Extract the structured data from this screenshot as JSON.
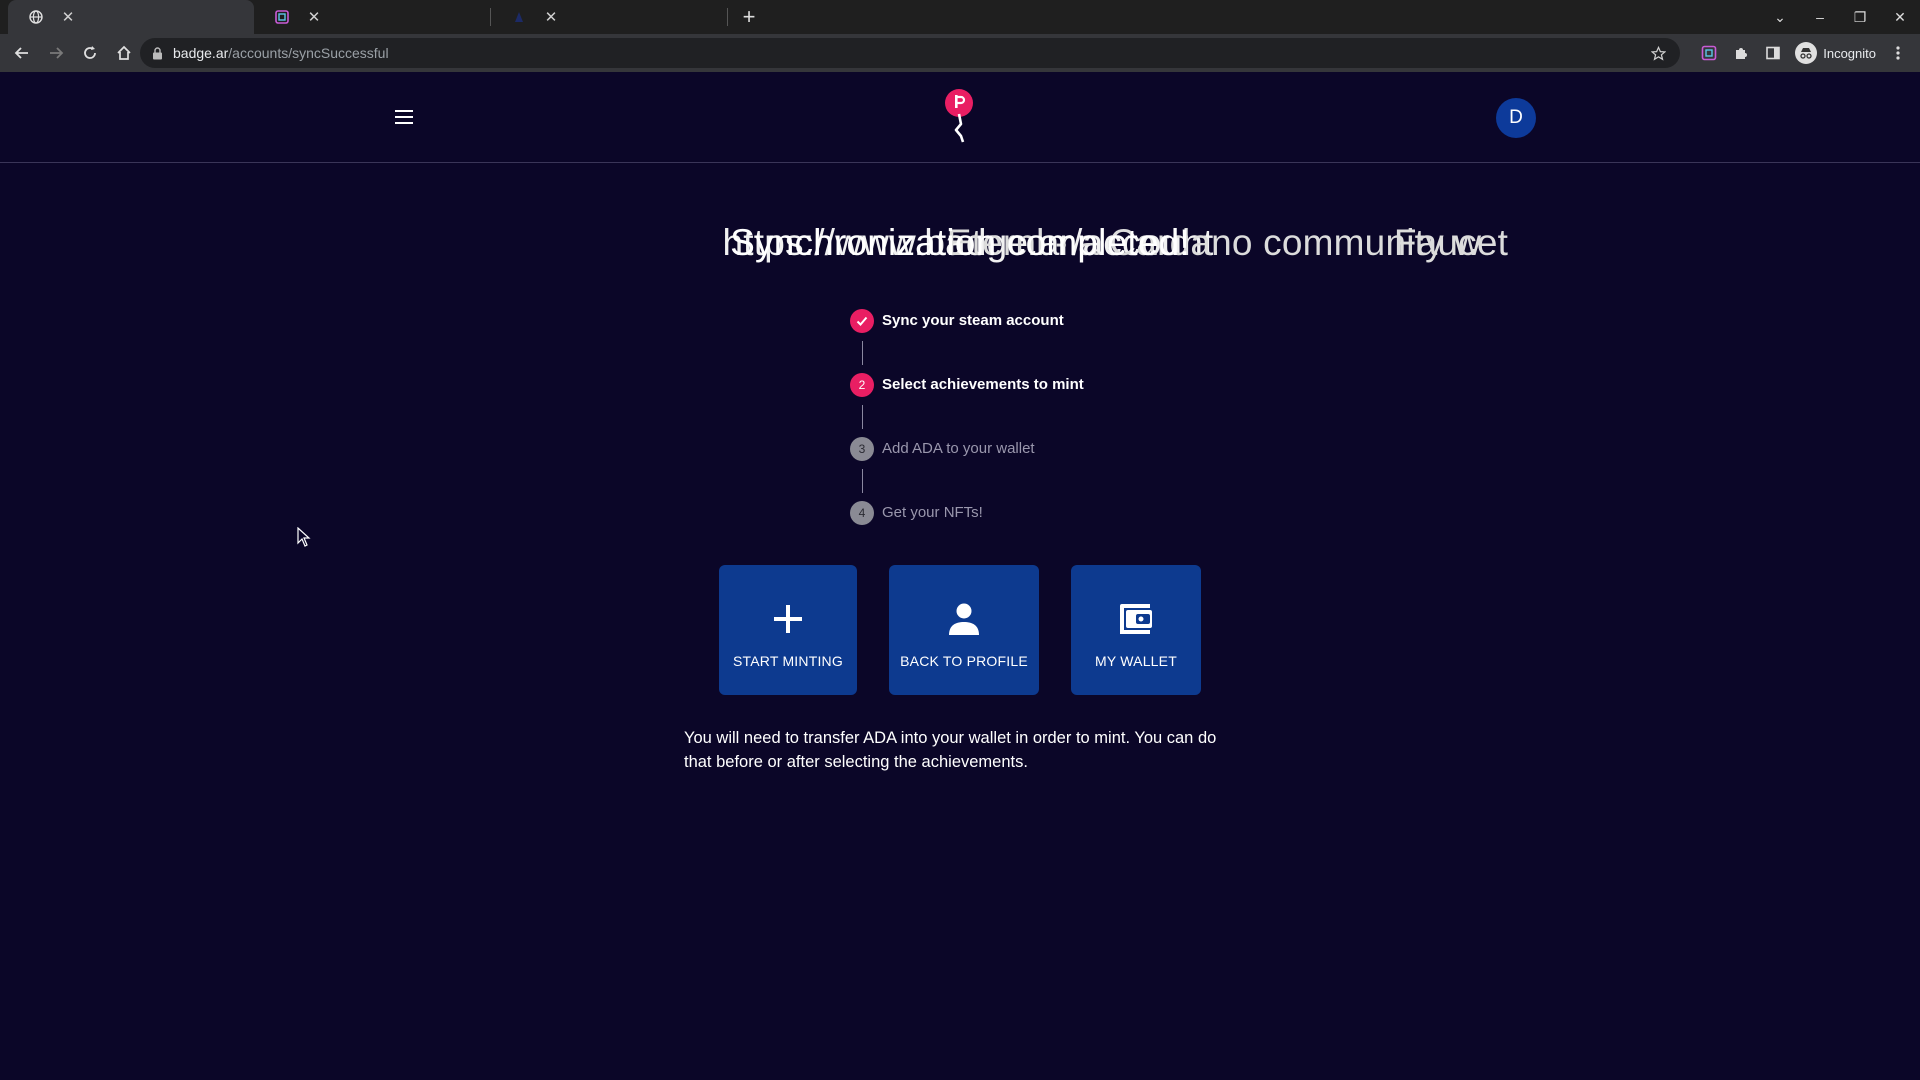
{
  "browser": {
    "tabs": [
      {
        "title": "https://www.badge.ar/account",
        "active": true
      },
      {
        "title": "Eternl - a Cardano community w",
        "active": false
      },
      {
        "title": "Faucet",
        "active": false
      }
    ],
    "url_host": "badge.ar",
    "url_path": "/accounts/syncSuccessful",
    "profile_label": "Incognito"
  },
  "header": {
    "avatar_letter": "D"
  },
  "main": {
    "title": "Synchronization completed!",
    "steps": [
      {
        "number": "",
        "label": "Sync your steam account",
        "state": "done"
      },
      {
        "number": "2",
        "label": "Select achievements to mint",
        "state": "active"
      },
      {
        "number": "3",
        "label": "Add ADA to your wallet",
        "state": "pending"
      },
      {
        "number": "4",
        "label": "Get your NFTs!",
        "state": "pending"
      }
    ],
    "actions": [
      {
        "label": "START MINTING",
        "icon": "plus-icon"
      },
      {
        "label": "BACK TO PROFILE",
        "icon": "person-icon"
      },
      {
        "label": "MY WALLET",
        "icon": "wallet-icon"
      }
    ],
    "note": "You will need to transfer ADA into your wallet in order to mint. You can do that before or after selecting the achievements."
  },
  "colors": {
    "background": "#0b0628",
    "accent_pink": "#e91e63",
    "button_blue": "#0d3a8f",
    "avatar_blue": "#0d3a9a"
  }
}
